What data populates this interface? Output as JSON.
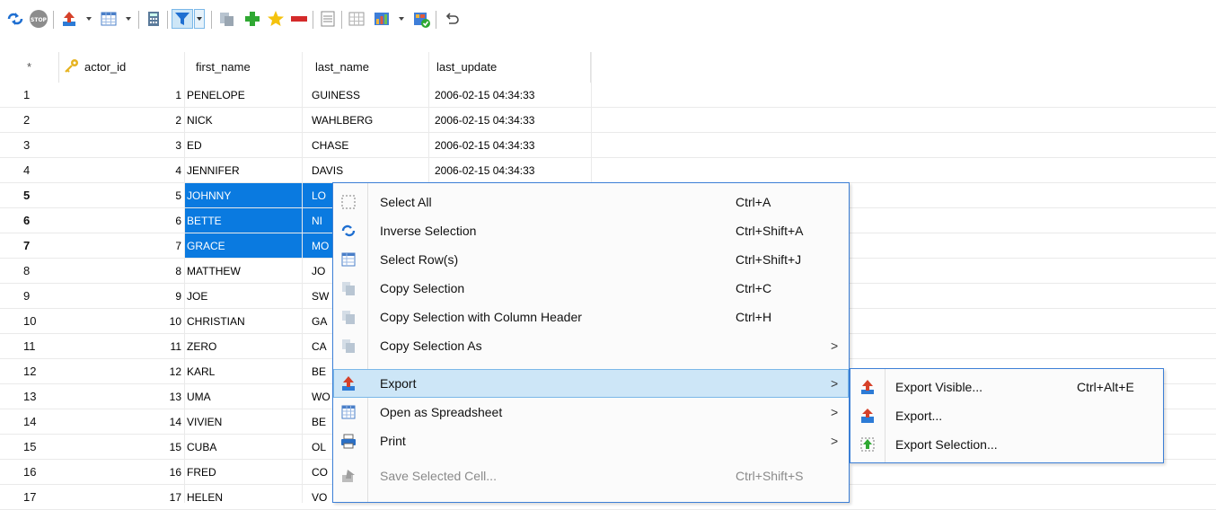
{
  "toolbar": {
    "icons": [
      "refresh-icon",
      "stop-icon",
      "import-icon",
      "table-view-icon",
      "form-view-icon",
      "filter-icon",
      "copy-record-icon",
      "add-record-icon",
      "favorite-icon",
      "delete-record-icon",
      "text-view-icon",
      "grid-view-icon",
      "chart-icon",
      "commit-icon",
      "undo-icon"
    ],
    "stop_label": "STOP"
  },
  "grid": {
    "star": "*",
    "columns": [
      "actor_id",
      "first_name",
      "last_name",
      "last_update"
    ],
    "rows": [
      {
        "num": "1",
        "actor_id": "1",
        "first_name": "PENELOPE",
        "last_name": "GUINESS",
        "last_update": "2006-02-15 04:34:33"
      },
      {
        "num": "2",
        "actor_id": "2",
        "first_name": "NICK",
        "last_name": "WAHLBERG",
        "last_update": "2006-02-15 04:34:33"
      },
      {
        "num": "3",
        "actor_id": "3",
        "first_name": "ED",
        "last_name": "CHASE",
        "last_update": "2006-02-15 04:34:33"
      },
      {
        "num": "4",
        "actor_id": "4",
        "first_name": "JENNIFER",
        "last_name": "DAVIS",
        "last_update": "2006-02-15 04:34:33"
      },
      {
        "num": "5",
        "actor_id": "5",
        "first_name": "JOHNNY",
        "last_name": "LO",
        "last_update": ""
      },
      {
        "num": "6",
        "actor_id": "6",
        "first_name": "BETTE",
        "last_name": "NI",
        "last_update": ""
      },
      {
        "num": "7",
        "actor_id": "7",
        "first_name": "GRACE",
        "last_name": "MO",
        "last_update": ""
      },
      {
        "num": "8",
        "actor_id": "8",
        "first_name": "MATTHEW",
        "last_name": "JO",
        "last_update": ""
      },
      {
        "num": "9",
        "actor_id": "9",
        "first_name": "JOE",
        "last_name": "SW",
        "last_update": ""
      },
      {
        "num": "10",
        "actor_id": "10",
        "first_name": "CHRISTIAN",
        "last_name": "GA",
        "last_update": ""
      },
      {
        "num": "11",
        "actor_id": "11",
        "first_name": "ZERO",
        "last_name": "CA",
        "last_update": ""
      },
      {
        "num": "12",
        "actor_id": "12",
        "first_name": "KARL",
        "last_name": "BE",
        "last_update": ""
      },
      {
        "num": "13",
        "actor_id": "13",
        "first_name": "UMA",
        "last_name": "WO",
        "last_update": ""
      },
      {
        "num": "14",
        "actor_id": "14",
        "first_name": "VIVIEN",
        "last_name": "BE",
        "last_update": ""
      },
      {
        "num": "15",
        "actor_id": "15",
        "first_name": "CUBA",
        "last_name": "OL",
        "last_update": ""
      },
      {
        "num": "16",
        "actor_id": "16",
        "first_name": "FRED",
        "last_name": "CO",
        "last_update": ""
      },
      {
        "num": "17",
        "actor_id": "17",
        "first_name": "HELEN",
        "last_name": "VO",
        "last_update": ""
      }
    ],
    "selected_rows": [
      "5",
      "6",
      "7"
    ]
  },
  "context_menu": {
    "items": [
      {
        "label": "Select All",
        "shortcut": "Ctrl+A",
        "icon": "select-all-icon",
        "submenu": false,
        "disabled": false
      },
      {
        "label": "Inverse Selection",
        "shortcut": "Ctrl+Shift+A",
        "icon": "inverse-selection-icon",
        "submenu": false,
        "disabled": false
      },
      {
        "label": "Select Row(s)",
        "shortcut": "Ctrl+Shift+J",
        "icon": "select-rows-icon",
        "submenu": false,
        "disabled": false
      },
      {
        "label": "Copy Selection",
        "shortcut": "Ctrl+C",
        "icon": "copy-icon",
        "submenu": false,
        "disabled": false
      },
      {
        "label": "Copy Selection with Column Header",
        "shortcut": "Ctrl+H",
        "icon": "copy-header-icon",
        "submenu": false,
        "disabled": false
      },
      {
        "label": "Copy Selection As",
        "shortcut": "",
        "icon": "copy-as-icon",
        "submenu": true,
        "disabled": false
      },
      {
        "label": "Export",
        "shortcut": "",
        "icon": "export-icon",
        "submenu": true,
        "disabled": false
      },
      {
        "label": "Open as Spreadsheet",
        "shortcut": "",
        "icon": "spreadsheet-icon",
        "submenu": true,
        "disabled": false
      },
      {
        "label": "Print",
        "shortcut": "",
        "icon": "print-icon",
        "submenu": true,
        "disabled": false
      },
      {
        "label": "Save Selected Cell...",
        "shortcut": "Ctrl+Shift+S",
        "icon": "save-cell-icon",
        "submenu": false,
        "disabled": true
      }
    ],
    "arrow": ">",
    "highlighted": "Export"
  },
  "export_submenu": {
    "items": [
      {
        "label": "Export Visible...",
        "shortcut": "Ctrl+Alt+E",
        "icon": "export-visible-icon"
      },
      {
        "label": "Export...",
        "shortcut": "",
        "icon": "export-all-icon"
      },
      {
        "label": "Export Selection...",
        "shortcut": "",
        "icon": "export-selection-icon"
      }
    ]
  },
  "colors": {
    "selection": "#0a7ae0",
    "menu_border": "#3c7fd6",
    "menu_highlight": "#cde6f7",
    "accent_green": "#2fa832",
    "accent_red": "#d42a2a",
    "star_yellow": "#f4c20d",
    "filter_blue": "#1f6fd1"
  }
}
